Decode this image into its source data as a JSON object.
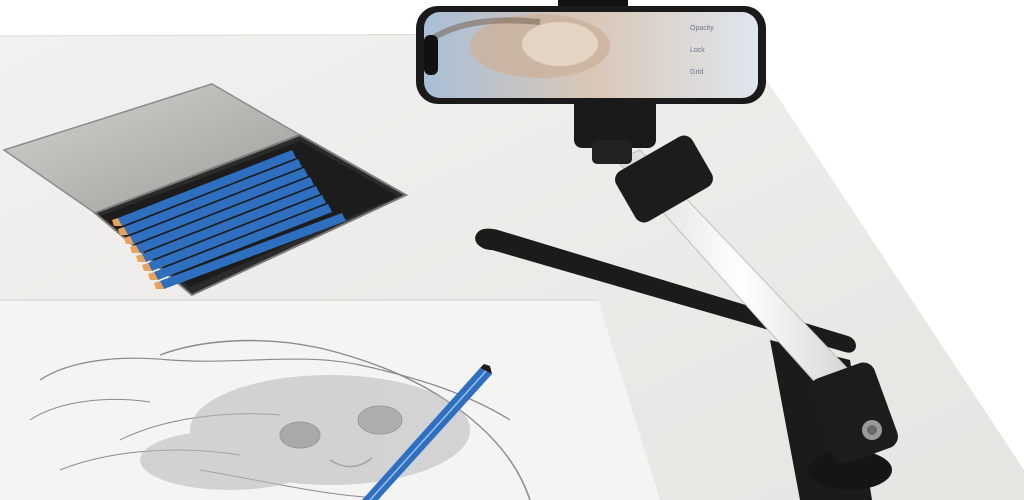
{
  "scene": {
    "subject": "",
    "colors": {
      "background": "#ffffff",
      "table": "#ebebea",
      "paper": "#f3f3f2",
      "pencil_blue": "#2f6fc0",
      "pencil_tip": "#e8a25a",
      "tin": "#b9b9b6",
      "mount_black": "#1b1b1b",
      "pole_white": "#f4f4f4"
    },
    "phone": {
      "screen_labels": [
        "Opacity",
        "Lock",
        "Grid"
      ]
    }
  }
}
